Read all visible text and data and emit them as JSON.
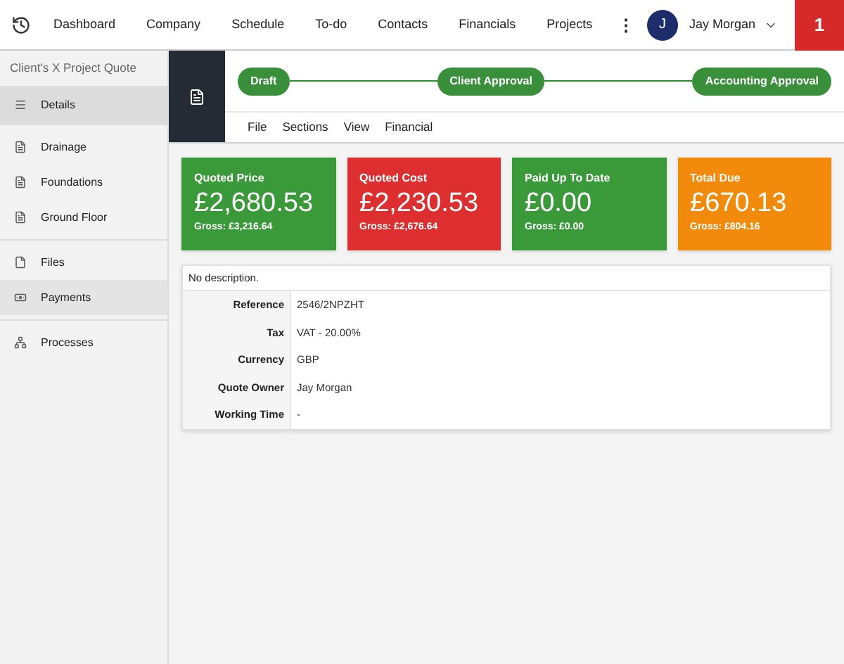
{
  "nav": {
    "items": [
      "Dashboard",
      "Company",
      "Schedule",
      "To-do",
      "Contacts",
      "Financials",
      "Projects"
    ],
    "more": "⋮",
    "user": {
      "initial": "J",
      "name": "Jay Morgan"
    },
    "notifications": "1"
  },
  "sidebar": {
    "title": "Client's X Project Quote",
    "groups": [
      [
        {
          "label": "Details",
          "kind": "list",
          "selected": true,
          "hovered": false
        }
      ],
      [
        {
          "label": "Drainage",
          "kind": "doc",
          "selected": false,
          "hovered": false
        },
        {
          "label": "Foundations",
          "kind": "doc",
          "selected": false,
          "hovered": false
        },
        {
          "label": "Ground Floor",
          "kind": "doc",
          "selected": false,
          "hovered": false
        }
      ],
      [
        {
          "label": "Files",
          "kind": "file",
          "selected": false,
          "hovered": false
        },
        {
          "label": "Payments",
          "kind": "money",
          "selected": false,
          "hovered": true
        }
      ],
      [
        {
          "label": "Processes",
          "kind": "tree",
          "selected": false,
          "hovered": false
        }
      ]
    ]
  },
  "stages": [
    "Draft",
    "Client Approval",
    "Accounting Approval"
  ],
  "menu": [
    "File",
    "Sections",
    "View",
    "Financial"
  ],
  "cards": [
    {
      "title": "Quoted Price",
      "value": "£2,680.53",
      "gross": "Gross: £3,216.64",
      "color": "#3a9a3a"
    },
    {
      "title": "Quoted Cost",
      "value": "£2,230.53",
      "gross": "Gross: £2,676.64",
      "color": "#dd2f2f"
    },
    {
      "title": "Paid Up To Date",
      "value": "£0.00",
      "gross": "Gross: £0.00",
      "color": "#3a9a3a"
    },
    {
      "title": "Total Due",
      "value": "£670.13",
      "gross": "Gross: £804.16",
      "color": "#f28a0c"
    }
  ],
  "details": {
    "description": "No description.",
    "rows": [
      {
        "label": "Reference",
        "value": "2546/2NPZHT"
      },
      {
        "label": "Tax",
        "value": "VAT - 20.00%"
      },
      {
        "label": "Currency",
        "value": "GBP"
      },
      {
        "label": "Quote Owner",
        "value": "Jay Morgan"
      },
      {
        "label": "Working Time",
        "value": "-"
      }
    ]
  }
}
